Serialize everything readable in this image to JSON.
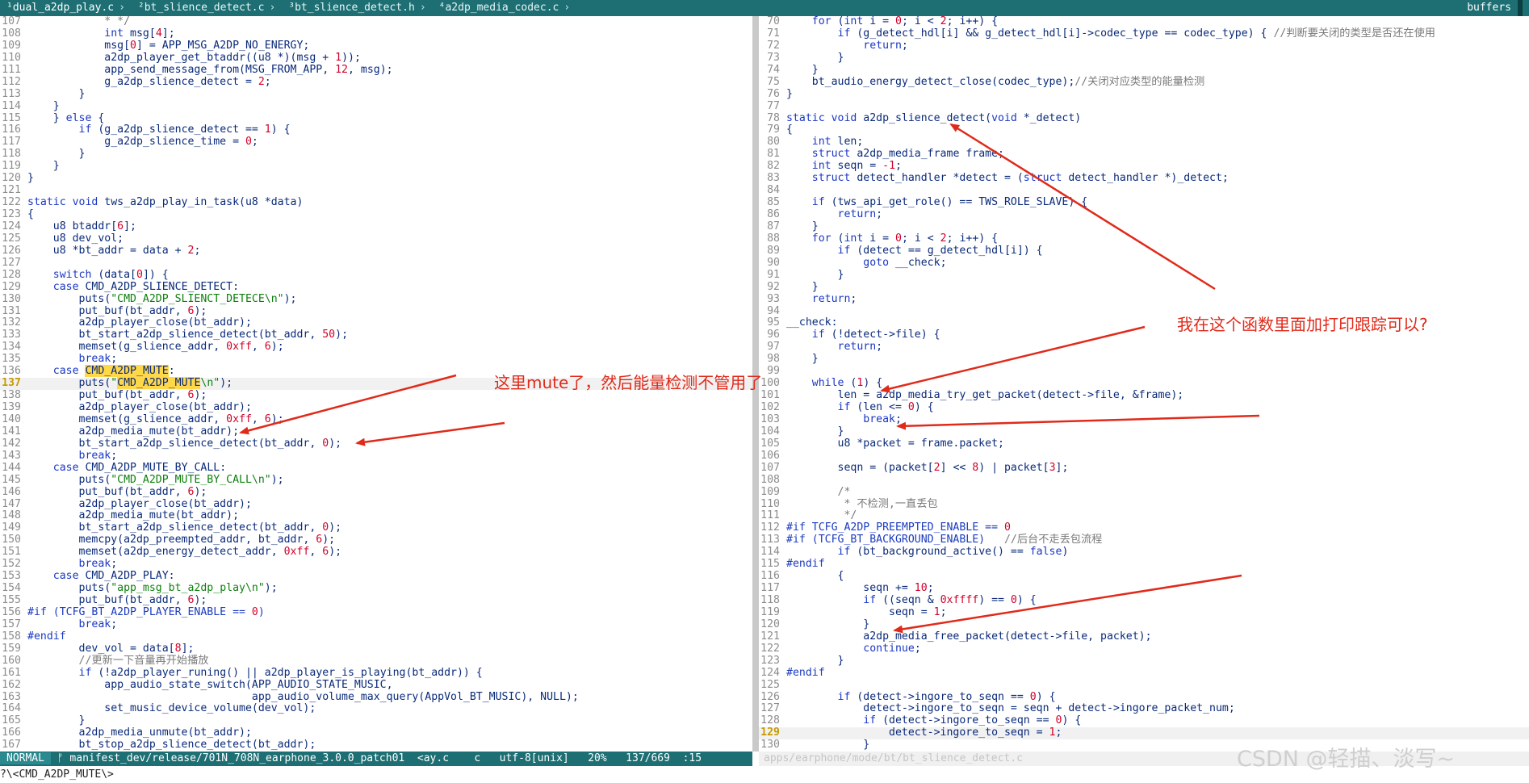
{
  "tabs": [
    {
      "label": "¹dual_a2dp_play.c",
      "active": true
    },
    {
      "label": "²bt_slience_detect.c",
      "active": false
    },
    {
      "label": "³bt_slience_detect.h",
      "active": false
    },
    {
      "label": "⁴a2dp_media_codec.c",
      "active": false
    }
  ],
  "buffers_label": "buffers",
  "left_pane": {
    "current_line": 137,
    "lines": [
      {
        "n": 107,
        "h": "            <span class=\"cmt\">* */</span>"
      },
      {
        "n": 108,
        "h": "            <span class=\"kw\">int</span> msg[<span class=\"num\">4</span>];"
      },
      {
        "n": 109,
        "h": "            msg[<span class=\"num\">0</span>] = APP_MSG_A2DP_NO_ENERGY;"
      },
      {
        "n": 110,
        "h": "            a2dp_player_get_btaddr((u8 *)(msg + <span class=\"num\">1</span>));"
      },
      {
        "n": 111,
        "h": "            app_send_message_from(MSG_FROM_APP, <span class=\"num\">12</span>, msg);"
      },
      {
        "n": 112,
        "h": "            g_a2dp_slience_detect = <span class=\"num\">2</span>;"
      },
      {
        "n": 113,
        "h": "        }"
      },
      {
        "n": 114,
        "h": "    }"
      },
      {
        "n": 115,
        "h": "    } <span class=\"kw\">else</span> {"
      },
      {
        "n": 116,
        "h": "        <span class=\"kw\">if</span> (g_a2dp_slience_detect == <span class=\"num\">1</span>) {"
      },
      {
        "n": 117,
        "h": "            g_a2dp_slience_time = <span class=\"num\">0</span>;"
      },
      {
        "n": 118,
        "h": "        }"
      },
      {
        "n": 119,
        "h": "    }"
      },
      {
        "n": 120,
        "h": "}"
      },
      {
        "n": 121,
        "h": ""
      },
      {
        "n": 122,
        "h": "<span class=\"kw\">static void</span> tws_a2dp_play_in_task(u8 *data)"
      },
      {
        "n": 123,
        "h": "{"
      },
      {
        "n": 124,
        "h": "    u8 btaddr[<span class=\"num\">6</span>];"
      },
      {
        "n": 125,
        "h": "    u8 dev_vol;"
      },
      {
        "n": 126,
        "h": "    u8 *bt_addr = data + <span class=\"num\">2</span>;"
      },
      {
        "n": 127,
        "h": ""
      },
      {
        "n": 128,
        "h": "    <span class=\"kw\">switch</span> (data[<span class=\"num\">0</span>]) {"
      },
      {
        "n": 129,
        "h": "    <span class=\"kw\">case</span> CMD_A2DP_SLIENCE_DETECT:"
      },
      {
        "n": 130,
        "h": "        puts(<span class=\"str\">\"CMD_A2DP_SLIENCT_DETECE\\n\"</span>);"
      },
      {
        "n": 131,
        "h": "        put_buf(bt_addr, <span class=\"num\">6</span>);"
      },
      {
        "n": 132,
        "h": "        a2dp_player_close(bt_addr);"
      },
      {
        "n": 133,
        "h": "        bt_start_a2dp_slience_detect(bt_addr, <span class=\"num\">50</span>);"
      },
      {
        "n": 134,
        "h": "        memset(g_slience_addr, <span class=\"num\">0xff</span>, <span class=\"num\">6</span>);"
      },
      {
        "n": 135,
        "h": "        <span class=\"kw\">break</span>;"
      },
      {
        "n": 136,
        "h": "    <span class=\"kw\">case</span> <span class=\"hl\">CMD_A2DP_MUTE</span>:"
      },
      {
        "n": 137,
        "h": "        puts(<span class=\"str\">\"<span class=\"hl\">CMD_A2DP_MUTE</span>\\n\"</span>);"
      },
      {
        "n": 138,
        "h": "        put_buf(bt_addr, <span class=\"num\">6</span>);"
      },
      {
        "n": 139,
        "h": "        a2dp_player_close(bt_addr);"
      },
      {
        "n": 140,
        "h": "        memset(g_slience_addr, <span class=\"num\">0xff</span>, <span class=\"num\">6</span>);"
      },
      {
        "n": 141,
        "h": "        a2dp_media_mute(bt_addr);"
      },
      {
        "n": 142,
        "h": "        bt_start_a2dp_slience_detect(bt_addr, <span class=\"num\">0</span>);"
      },
      {
        "n": 143,
        "h": "        <span class=\"kw\">break</span>;"
      },
      {
        "n": 144,
        "h": "    <span class=\"kw\">case</span> CMD_A2DP_MUTE_BY_CALL:"
      },
      {
        "n": 145,
        "h": "        puts(<span class=\"str\">\"CMD_A2DP_MUTE_BY_CALL\\n\"</span>);"
      },
      {
        "n": 146,
        "h": "        put_buf(bt_addr, <span class=\"num\">6</span>);"
      },
      {
        "n": 147,
        "h": "        a2dp_player_close(bt_addr);"
      },
      {
        "n": 148,
        "h": "        a2dp_media_mute(bt_addr);"
      },
      {
        "n": 149,
        "h": "        bt_start_a2dp_slience_detect(bt_addr, <span class=\"num\">0</span>);"
      },
      {
        "n": 150,
        "h": "        memcpy(a2dp_preempted_addr, bt_addr, <span class=\"num\">6</span>);"
      },
      {
        "n": 151,
        "h": "        memset(a2dp_energy_detect_addr, <span class=\"num\">0xff</span>, <span class=\"num\">6</span>);"
      },
      {
        "n": 152,
        "h": "        <span class=\"kw\">break</span>;"
      },
      {
        "n": 153,
        "h": "    <span class=\"kw\">case</span> CMD_A2DP_PLAY:"
      },
      {
        "n": 154,
        "h": "        puts(<span class=\"str\">\"app_msg_bt_a2dp_play\\n\"</span>);"
      },
      {
        "n": 155,
        "h": "        put_buf(bt_addr, <span class=\"num\">6</span>);"
      },
      {
        "n": 156,
        "h": "<span class=\"pp\">#if (TCFG_BT_A2DP_PLAYER_ENABLE == </span><span class=\"num\">0</span><span class=\"pp\">)</span>"
      },
      {
        "n": 157,
        "h": "        <span class=\"kw\">break</span>;"
      },
      {
        "n": 158,
        "h": "<span class=\"pp\">#endif</span>"
      },
      {
        "n": 159,
        "h": "        dev_vol = data[<span class=\"num\">8</span>];"
      },
      {
        "n": 160,
        "h": "        <span class=\"cmt\">//更新一下音量再开始播放</span>"
      },
      {
        "n": 161,
        "h": "        <span class=\"kw\">if</span> (!a2dp_player_runing() || a2dp_player_is_playing(bt_addr)) {"
      },
      {
        "n": 162,
        "h": "            app_audio_state_switch(APP_AUDIO_STATE_MUSIC,"
      },
      {
        "n": 163,
        "h": "                                   app_audio_volume_max_query(AppVol_BT_MUSIC), NULL);"
      },
      {
        "n": 164,
        "h": "            set_music_device_volume(dev_vol);"
      },
      {
        "n": 165,
        "h": "        }"
      },
      {
        "n": 166,
        "h": "        a2dp_media_unmute(bt_addr);"
      },
      {
        "n": 167,
        "h": "        bt_stop_a2dp_slience_detect(bt_addr);"
      }
    ]
  },
  "right_pane": {
    "current_line": 129,
    "lines": [
      {
        "n": 70,
        "h": "    <span class=\"kw\">for</span> (<span class=\"kw\">int</span> i = <span class=\"num\">0</span>; i &lt; <span class=\"num\">2</span>; i++) {"
      },
      {
        "n": 71,
        "h": "        <span class=\"kw\">if</span> (g_detect_hdl[i] &amp;&amp; g_detect_hdl[i]-&gt;codec_type == codec_type) { <span class=\"cmt\">//判断要关闭的类型是否还在使用</span>"
      },
      {
        "n": 72,
        "h": "            <span class=\"kw\">return</span>;"
      },
      {
        "n": 73,
        "h": "        }"
      },
      {
        "n": 74,
        "h": "    }"
      },
      {
        "n": 75,
        "h": "    bt_audio_energy_detect_close(codec_type);<span class=\"cmt\">//关闭对应类型的能量检测</span>"
      },
      {
        "n": 76,
        "h": "}"
      },
      {
        "n": 77,
        "h": ""
      },
      {
        "n": 78,
        "h": "<span class=\"kw\">static void</span> a2dp_slience_detect(<span class=\"kw\">void</span> *_detect)"
      },
      {
        "n": 79,
        "h": "{"
      },
      {
        "n": 80,
        "h": "    <span class=\"kw\">int</span> len;"
      },
      {
        "n": 81,
        "h": "    <span class=\"kw\">struct</span> a2dp_media_frame frame;"
      },
      {
        "n": 82,
        "h": "    <span class=\"kw\">int</span> seqn = <span class=\"num\">-1</span>;"
      },
      {
        "n": 83,
        "h": "    <span class=\"kw\">struct</span> detect_handler *detect = (<span class=\"kw\">struct</span> detect_handler *)_detect;"
      },
      {
        "n": 84,
        "h": ""
      },
      {
        "n": 85,
        "h": "    <span class=\"kw\">if</span> (tws_api_get_role() == TWS_ROLE_SLAVE) {"
      },
      {
        "n": 86,
        "h": "        <span class=\"kw\">return</span>;"
      },
      {
        "n": 87,
        "h": "    }"
      },
      {
        "n": 88,
        "h": "    <span class=\"kw\">for</span> (<span class=\"kw\">int</span> i = <span class=\"num\">0</span>; i &lt; <span class=\"num\">2</span>; i++) {"
      },
      {
        "n": 89,
        "h": "        <span class=\"kw\">if</span> (detect == g_detect_hdl[i]) {"
      },
      {
        "n": 90,
        "h": "            <span class=\"kw\">goto</span> __check;"
      },
      {
        "n": 91,
        "h": "        }"
      },
      {
        "n": 92,
        "h": "    }"
      },
      {
        "n": 93,
        "h": "    <span class=\"kw\">return</span>;"
      },
      {
        "n": 94,
        "h": ""
      },
      {
        "n": 95,
        "h": "__check:"
      },
      {
        "n": 96,
        "h": "    <span class=\"kw\">if</span> (!detect-&gt;file) {"
      },
      {
        "n": 97,
        "h": "        <span class=\"kw\">return</span>;"
      },
      {
        "n": 98,
        "h": "    }"
      },
      {
        "n": 99,
        "h": ""
      },
      {
        "n": 100,
        "h": "    <span class=\"kw\">while</span> (<span class=\"num\">1</span>) {"
      },
      {
        "n": 101,
        "h": "        len = a2dp_media_try_get_packet(detect-&gt;file, &amp;frame);"
      },
      {
        "n": 102,
        "h": "        <span class=\"kw\">if</span> (len &lt;= <span class=\"num\">0</span>) {"
      },
      {
        "n": 103,
        "h": "            <span class=\"kw\">break</span>;"
      },
      {
        "n": 104,
        "h": "        }"
      },
      {
        "n": 105,
        "h": "        u8 *packet = frame.packet;"
      },
      {
        "n": 106,
        "h": ""
      },
      {
        "n": 107,
        "h": "        seqn = (packet[<span class=\"num\">2</span>] &lt;&lt; <span class=\"num\">8</span>) | packet[<span class=\"num\">3</span>];"
      },
      {
        "n": 108,
        "h": ""
      },
      {
        "n": 109,
        "h": "        <span class=\"cmt\">/*</span>"
      },
      {
        "n": 110,
        "h": "         <span class=\"cmt\">* 不检测,一直丢包</span>"
      },
      {
        "n": 111,
        "h": "         <span class=\"cmt\">*/</span>"
      },
      {
        "n": 112,
        "h": "<span class=\"pp\">#if TCFG_A2DP_PREEMPTED_ENABLE == </span><span class=\"num\">0</span>"
      },
      {
        "n": 113,
        "h": "<span class=\"pp\">#if (TCFG_BT_BACKGROUND_ENABLE)</span>   <span class=\"cmt\">//后台不走丢包流程</span>"
      },
      {
        "n": 114,
        "h": "        <span class=\"kw\">if</span> (bt_background_active() == <span class=\"kw\">false</span>)"
      },
      {
        "n": 115,
        "h": "<span class=\"pp\">#endif</span>"
      },
      {
        "n": 116,
        "h": "        {"
      },
      {
        "n": 117,
        "h": "            seqn += <span class=\"num\">10</span>;"
      },
      {
        "n": 118,
        "h": "            <span class=\"kw\">if</span> ((seqn &amp; <span class=\"num\">0xffff</span>) == <span class=\"num\">0</span>) {"
      },
      {
        "n": 119,
        "h": "                seqn = <span class=\"num\">1</span>;"
      },
      {
        "n": 120,
        "h": "            }"
      },
      {
        "n": 121,
        "h": "            a2dp_media_free_packet(detect-&gt;file, packet);"
      },
      {
        "n": 122,
        "h": "            <span class=\"kw\">continue</span>;"
      },
      {
        "n": 123,
        "h": "        }"
      },
      {
        "n": 124,
        "h": "<span class=\"pp\">#endif</span>"
      },
      {
        "n": 125,
        "h": ""
      },
      {
        "n": 126,
        "h": "        <span class=\"kw\">if</span> (detect-&gt;ingore_to_seqn == <span class=\"num\">0</span>) {"
      },
      {
        "n": 127,
        "h": "            detect-&gt;ingore_to_seqn = seqn + detect-&gt;ingore_packet_num;"
      },
      {
        "n": 128,
        "h": "            <span class=\"kw\">if</span> (detect-&gt;ingore_to_seqn == <span class=\"num\">0</span>) {"
      },
      {
        "n": 129,
        "h": "                detect-&gt;ingore_to_seqn = <span class=\"num\">1</span>;"
      },
      {
        "n": 130,
        "h": "            }"
      }
    ]
  },
  "status_left": {
    "mode": "NORMAL",
    "rest": " ᚠ manifest_dev/release/701N_708N_earphone_3.0.0_patch01  <ay.c    c   utf-8[unix]   20%   137/669  :15 "
  },
  "status_right": {
    "text": "apps/earphone/mode/bt/bt_slience_detect.c"
  },
  "command_line": "?\\<CMD_A2DP_MUTE\\>",
  "annotations": {
    "mute_note": "这里mute了，然后能量检测不管用了",
    "trace_note": "我在这个函数里面加打印跟踪可以?"
  },
  "watermark": "CSDN @轻描、淡写~"
}
